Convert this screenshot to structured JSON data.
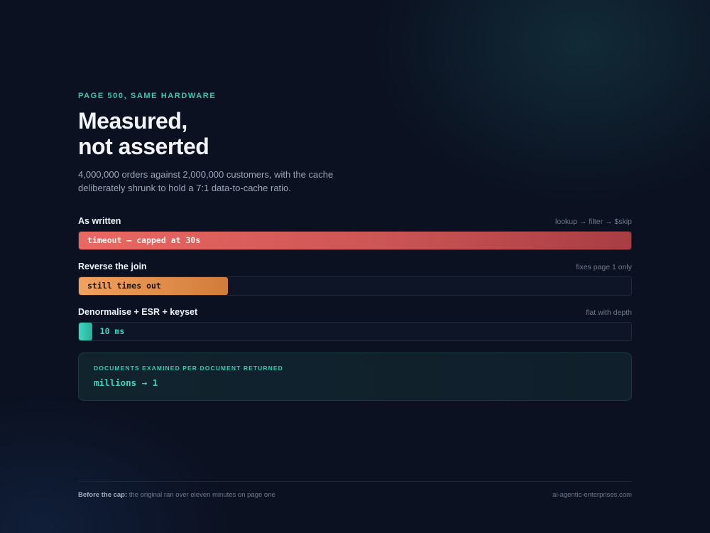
{
  "header": {
    "eyebrow": "PAGE 500, SAME HARDWARE",
    "title_line1": "Measured,",
    "title_line2": "not asserted",
    "subtitle": "4,000,000 orders against 2,000,000 customers, with the cache deliberately shrunk to hold a 7:1 data-to-cache ratio."
  },
  "rows": [
    {
      "label": "As written",
      "note": "lookup → filter → $skip",
      "bar_text": "timeout — capped at 30s",
      "fill_fraction": 1.0,
      "color": "#e5635f"
    },
    {
      "label": "Reverse the join",
      "note": "fixes page 1 only",
      "bar_text": "still times out",
      "fill_fraction": 0.27,
      "color": "#e8904b"
    },
    {
      "label": "Denormalise + ESR + keyset",
      "note": "flat with depth",
      "bar_text": "10 ms",
      "fill_fraction": 0.024,
      "color": "#35c8b1"
    }
  ],
  "stat_card": {
    "label": "DOCUMENTS EXAMINED PER DOCUMENT RETURNED",
    "value": "millions → 1"
  },
  "footer": {
    "note_bold": "Before the cap:",
    "note_text": " the original ran over eleven minutes on page one",
    "site": "ai-agentic-enterprises.com"
  }
}
